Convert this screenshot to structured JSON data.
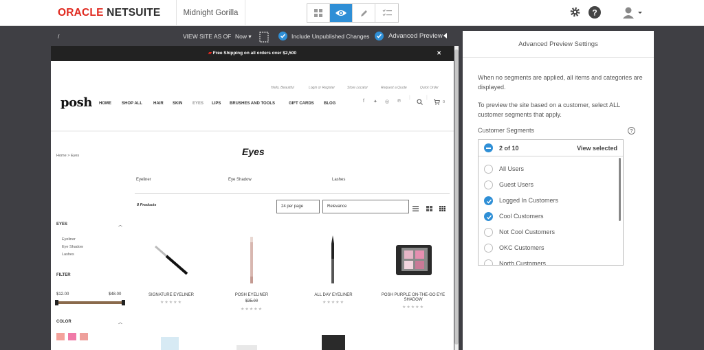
{
  "header": {
    "logo_oracle": "ORACLE",
    "logo_netsuite": "NETSUITE",
    "account_name": "Midnight Gorilla",
    "modes": [
      "grid-icon",
      "eye-icon",
      "pencil-icon",
      "checklist-icon"
    ],
    "active_mode": "eye-icon"
  },
  "toolbar": {
    "path": "/",
    "view_site_as_of": "VIEW SITE AS OF",
    "date_value": "Now",
    "include_unpublished": "Include Unpublished Changes",
    "advanced_preview": "Advanced Preview"
  },
  "site": {
    "shipping_banner": "Free Shipping on all orders over $2,500",
    "util_links": [
      "Hello, Beautiful",
      "Login or Register",
      "Store Locator",
      "Request a Quote",
      "Quick Order"
    ],
    "brand": "posh",
    "nav": [
      "HOME",
      "SHOP ALL",
      "HAIR",
      "SKIN",
      "EYES",
      "LIPS",
      "BRUSHES AND TOOLS",
      "GIFT CARDS",
      "BLOG"
    ],
    "cart_count": "0",
    "breadcrumb": "Home  >  Eyes",
    "page_title": "Eyes",
    "subcategories": [
      "Eyeliner",
      "Eye Shadow",
      "Lashes"
    ],
    "product_count": "8 Products",
    "per_page": "24 per page",
    "sort": "Relevance",
    "sidebar": {
      "eyes_heading": "EYES",
      "eyes_items": [
        "Eyeliner",
        "Eye Shadow",
        "Lashes"
      ],
      "filter_heading": "FILTER",
      "price_min": "$12.00",
      "price_max": "$48.00",
      "color_heading": "COLOR",
      "swatches": [
        "#f4a29b",
        "#f07aa8",
        "#ee9f9b"
      ]
    },
    "products": [
      {
        "name": "SIGNATURE EYELINER",
        "price": ""
      },
      {
        "name": "POSH EYELINER",
        "price": "$25.00"
      },
      {
        "name": "ALL DAY EYELINER",
        "price": ""
      },
      {
        "name": "POSH PURPLE ON-THE-GO EYE SHADOW",
        "price": ""
      }
    ],
    "stars": "★★★★★"
  },
  "panel": {
    "title": "Advanced Preview Settings",
    "para1": "When no segments are applied, all items and categories are displayed.",
    "para2": "To preview the site based on a customer, select ALL customer segments that apply.",
    "segments_label": "Customer Segments",
    "help": "?",
    "selected_count": "2 of 10",
    "view_selected": "View selected",
    "options": [
      {
        "label": "All Users",
        "checked": false
      },
      {
        "label": "Guest Users",
        "checked": false
      },
      {
        "label": "Logged In Customers",
        "checked": true
      },
      {
        "label": "Cool Customers",
        "checked": true
      },
      {
        "label": "Not Cool Customers",
        "checked": false
      },
      {
        "label": "OKC Customers",
        "checked": false
      },
      {
        "label": "North Customers",
        "checked": false
      }
    ]
  },
  "colors": {
    "accent": "#2f8fd6",
    "oracle_red": "#e0291f",
    "background": "#3f3f44"
  }
}
